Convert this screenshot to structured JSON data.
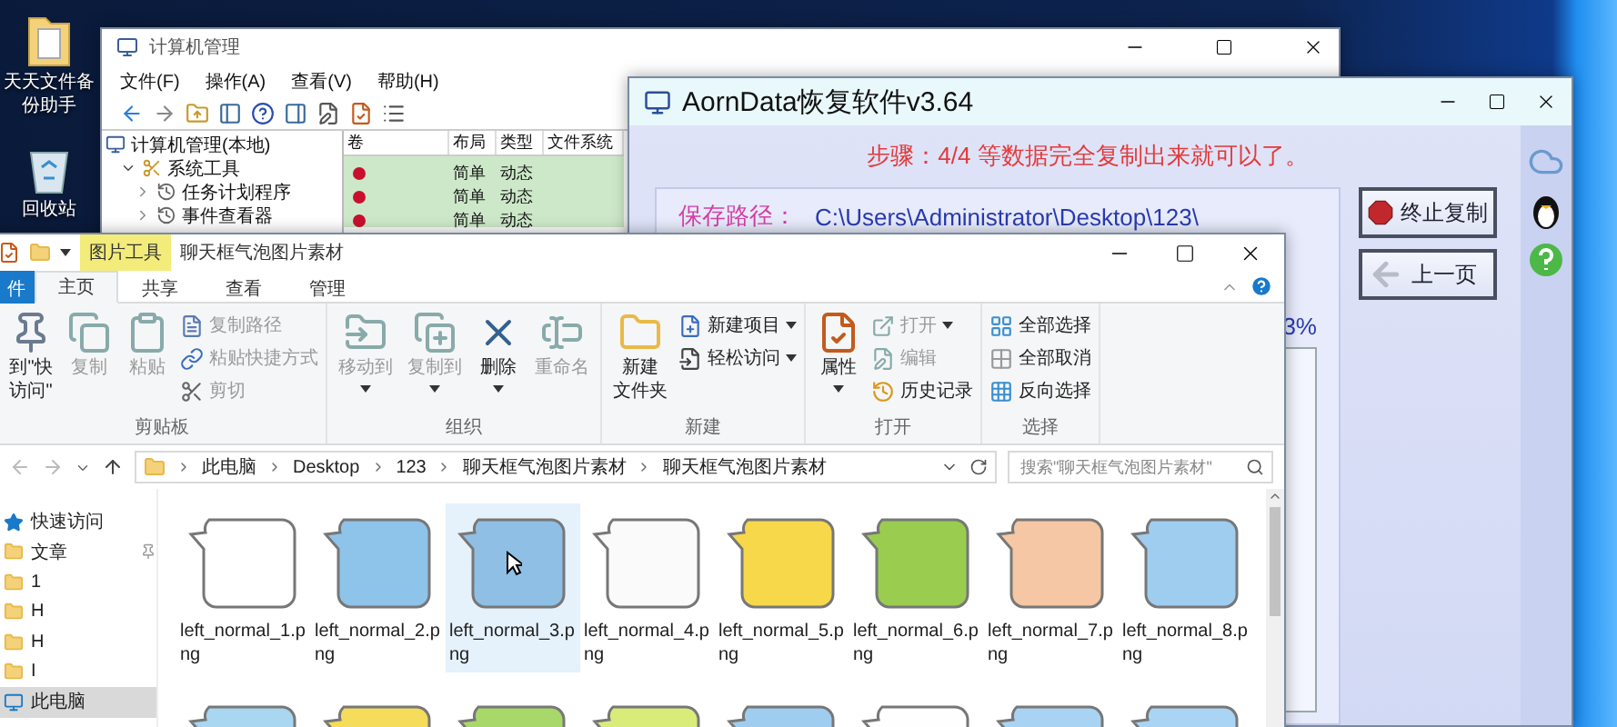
{
  "desktop": {
    "icons": [
      {
        "label": "天天文件备份助手",
        "kind": "folder"
      },
      {
        "label": "回收站",
        "kind": "recycle"
      }
    ]
  },
  "computer_management": {
    "title": "计算机管理",
    "menu": [
      "文件(F)",
      "操作(A)",
      "查看(V)",
      "帮助(H)"
    ],
    "tree": [
      {
        "label": "计算机管理(本地)",
        "children": [
          {
            "label": "系统工具",
            "expanded": true,
            "children": [
              {
                "label": "任务计划程序",
                "expanded": false
              },
              {
                "label": "事件查看器",
                "expanded": false
              }
            ]
          }
        ]
      }
    ],
    "table": {
      "columns": [
        "卷",
        "布局",
        "类型",
        "文件系统"
      ],
      "rows": [
        {
          "layout": "简单",
          "type": "动态"
        },
        {
          "layout": "简单",
          "type": "动态"
        },
        {
          "layout": "简单",
          "type": "动态"
        }
      ]
    }
  },
  "recovery": {
    "title": "AornData恢复软件v3.64",
    "step": "步骤：4/4 等数据完全复制出来就可以了。",
    "save_path_label": "保存路径：",
    "save_path": "C:\\Users\\Administrator\\Desktop\\123\\",
    "progress_text": "3%",
    "buttons": [
      {
        "label": "终止复制",
        "kind": "stop"
      },
      {
        "label": "上一页",
        "kind": "back"
      }
    ]
  },
  "explorer": {
    "context_tab": "图片工具",
    "title": "聊天框气泡图片素材",
    "tabs": [
      {
        "label": "件",
        "kind": "file",
        "selected": false
      },
      {
        "label": "主页",
        "kind": "tab",
        "selected": true
      },
      {
        "label": "共享",
        "kind": "tab",
        "selected": false
      },
      {
        "label": "查看",
        "kind": "tab",
        "selected": false
      },
      {
        "label": "管理",
        "kind": "tab",
        "selected": false
      }
    ],
    "ribbon": [
      {
        "label": "剪贴板",
        "items": [
          {
            "lines": [
              "到\"快",
              "访问\""
            ],
            "kind": "large",
            "disabled": false,
            "dropdown": false
          },
          {
            "label": "复制",
            "kind": "large",
            "disabled": true,
            "dropdown": false
          },
          {
            "label": "粘贴",
            "kind": "large",
            "disabled": true,
            "dropdown": false
          },
          {
            "label": "复制路径",
            "kind": "small",
            "disabled": true,
            "dropdown": false
          },
          {
            "label": "粘贴快捷方式",
            "kind": "small",
            "disabled": true,
            "dropdown": false
          },
          {
            "label": "剪切",
            "kind": "small",
            "disabled": true,
            "dropdown": false
          }
        ]
      },
      {
        "label": "组织",
        "items": [
          {
            "label": "移动到",
            "kind": "large",
            "disabled": true,
            "dropdown": true
          },
          {
            "label": "复制到",
            "kind": "large",
            "disabled": true,
            "dropdown": true
          },
          {
            "label": "删除",
            "kind": "large",
            "disabled": false,
            "dropdown": true
          },
          {
            "label": "重命名",
            "kind": "large",
            "disabled": true,
            "dropdown": false
          }
        ]
      },
      {
        "label": "新建",
        "items": [
          {
            "lines": [
              "新建",
              "文件夹"
            ],
            "kind": "large",
            "disabled": false,
            "dropdown": false
          },
          {
            "label": "新建项目",
            "kind": "small",
            "disabled": false,
            "dropdown": true
          },
          {
            "label": "轻松访问",
            "kind": "small",
            "disabled": false,
            "dropdown": true
          }
        ]
      },
      {
        "label": "打开",
        "items": [
          {
            "label": "属性",
            "kind": "large",
            "disabled": false,
            "dropdown": true
          },
          {
            "label": "打开",
            "kind": "small",
            "disabled": true,
            "dropdown": true
          },
          {
            "label": "编辑",
            "kind": "small",
            "disabled": true,
            "dropdown": false
          },
          {
            "label": "历史记录",
            "kind": "small",
            "disabled": false,
            "dropdown": false
          }
        ]
      },
      {
        "label": "选择",
        "items": [
          {
            "label": "全部选择",
            "kind": "small",
            "disabled": false,
            "dropdown": false
          },
          {
            "label": "全部取消",
            "kind": "small",
            "disabled": false,
            "dropdown": false
          },
          {
            "label": "反向选择",
            "kind": "small",
            "disabled": false,
            "dropdown": false
          }
        ]
      }
    ],
    "address": [
      "此电脑",
      "Desktop",
      "123",
      "聊天框气泡图片素材",
      "聊天框气泡图片素材"
    ],
    "search": {
      "placeholder": "搜索\"聊天框气泡图片素材\""
    },
    "nav": [
      {
        "label": "快速访问",
        "kind": "quick",
        "pinned": false,
        "selected": false
      },
      {
        "label": "文章",
        "kind": "folder",
        "pinned": true,
        "selected": false
      },
      {
        "label": "1",
        "kind": "folder",
        "pinned": false,
        "selected": false
      },
      {
        "label": "H",
        "kind": "folder",
        "pinned": false,
        "selected": false
      },
      {
        "label": "H",
        "kind": "folder",
        "pinned": false,
        "selected": false
      },
      {
        "label": "I",
        "kind": "folder",
        "pinned": false,
        "selected": false
      },
      {
        "label": "此电脑",
        "kind": "pc",
        "pinned": false,
        "selected": true
      }
    ],
    "files": [
      {
        "name": "left_normal_1.png",
        "color": "#ffffff",
        "selected": false
      },
      {
        "name": "left_normal_2.png",
        "color": "#8ec3ea",
        "selected": false
      },
      {
        "name": "left_normal_3.png",
        "color": "#8fbfe4",
        "selected": true
      },
      {
        "name": "left_normal_4.png",
        "color": "#fafafa",
        "selected": false
      },
      {
        "name": "left_normal_5.png",
        "color": "#f7d84a",
        "selected": false
      },
      {
        "name": "left_normal_6.png",
        "color": "#9acd4f",
        "selected": false
      },
      {
        "name": "left_normal_7.png",
        "color": "#f5c7a4",
        "selected": false
      },
      {
        "name": "left_normal_8.png",
        "color": "#9fcdf0",
        "selected": false
      }
    ],
    "more_files": [
      {
        "color": "#a9d6f0"
      },
      {
        "color": "#f5dc5a"
      },
      {
        "color": "#a8d86a"
      },
      {
        "color": "#d9ec7a"
      },
      {
        "color": "#9fcdf0"
      },
      {
        "color": "#fefefe"
      },
      {
        "color": "#a9d3f2"
      },
      {
        "color": "#aad4f3"
      }
    ]
  }
}
